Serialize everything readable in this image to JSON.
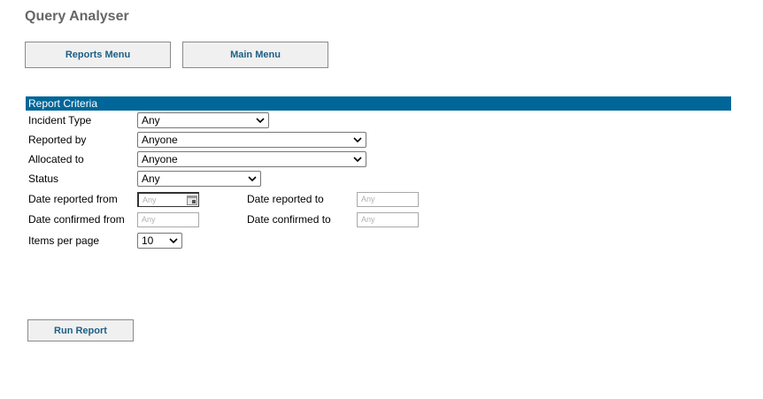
{
  "app": {
    "title": "Query Analyser"
  },
  "nav": {
    "reports_menu": "Reports Menu",
    "main_menu": "Main Menu"
  },
  "criteria": {
    "header": "Report Criteria",
    "incident_type": {
      "label": "Incident Type",
      "value": "Any"
    },
    "reported_by": {
      "label": "Reported by",
      "value": "Anyone"
    },
    "allocated_to": {
      "label": "Allocated to",
      "value": "Anyone"
    },
    "status": {
      "label": "Status",
      "value": "Any"
    },
    "date_reported_from": {
      "label": "Date reported from",
      "placeholder": "Any"
    },
    "date_reported_to": {
      "label": "Date reported to",
      "placeholder": "Any"
    },
    "date_confirmed_from": {
      "label": "Date confirmed from",
      "placeholder": "Any"
    },
    "date_confirmed_to": {
      "label": "Date confirmed to",
      "placeholder": "Any"
    },
    "items_per_page": {
      "label": "Items per page",
      "value": "10"
    }
  },
  "actions": {
    "run_report": "Run Report"
  },
  "colors": {
    "header_bg": "#006699",
    "button_text": "#1c5f85",
    "title_text": "#666666"
  },
  "icons": {
    "dropdown": "chevron-down-icon",
    "calendar": "calendar-icon"
  }
}
